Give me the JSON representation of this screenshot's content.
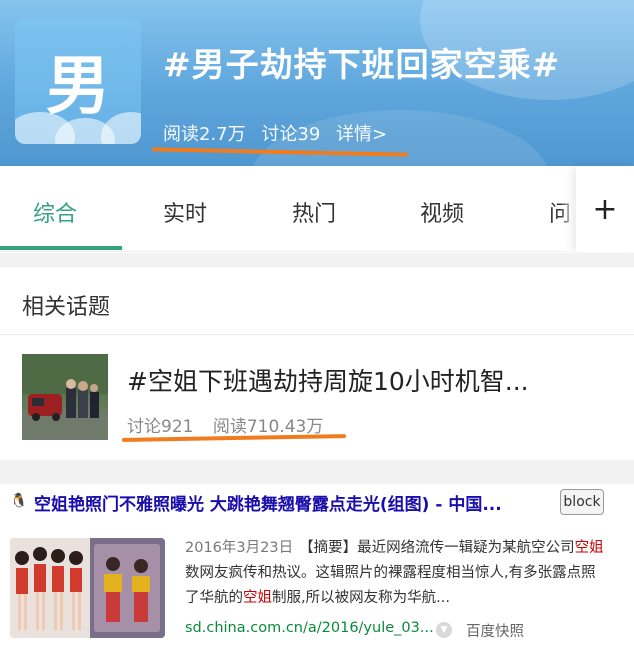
{
  "header": {
    "avatar_glyph": "男",
    "title": "#男子劫持下班回家空乘#",
    "reads": "阅读2.7万",
    "discussions": "讨论39",
    "details": "详情>"
  },
  "tabs": [
    {
      "label": "综合",
      "active": true
    },
    {
      "label": "实时",
      "active": false
    },
    {
      "label": "热门",
      "active": false
    },
    {
      "label": "视频",
      "active": false
    },
    {
      "label": "问",
      "active": false
    }
  ],
  "plus_icon": "plus-icon",
  "related": {
    "heading": "相关话题",
    "item": {
      "title": "#空姐下班遇劫持周旋10小时机智...",
      "discussions": "讨论921",
      "reads": "阅读710.43万"
    }
  },
  "result": {
    "favicon": "🐧",
    "title": "空姐艳照门不雅照曝光 大跳艳舞翘臀露点走光(组图) - 中国...",
    "block_label": "block",
    "snippet": {
      "date": "2016年3月23日",
      "line1_a": "【摘要】最近网络流传一辑疑为某航空公司",
      "line1_hl": "空姐",
      "line2": "数网友疯传和热议。这辑照片的裸露程度相当惊人,有多张露点照",
      "line3_a": "了华航的",
      "line3_hl": "空姐",
      "line3_b": "制服,所以被网友称为华航..."
    },
    "url": "sd.china.com.cn/a/2016/yule_03...",
    "cache_label": "百度快照"
  },
  "colors": {
    "accent_green": "#35a37d",
    "annotation_orange": "#f07c1e",
    "link_blue": "#1a0dab",
    "url_green": "#0a8a3a",
    "highlight_red": "#cc0000"
  }
}
